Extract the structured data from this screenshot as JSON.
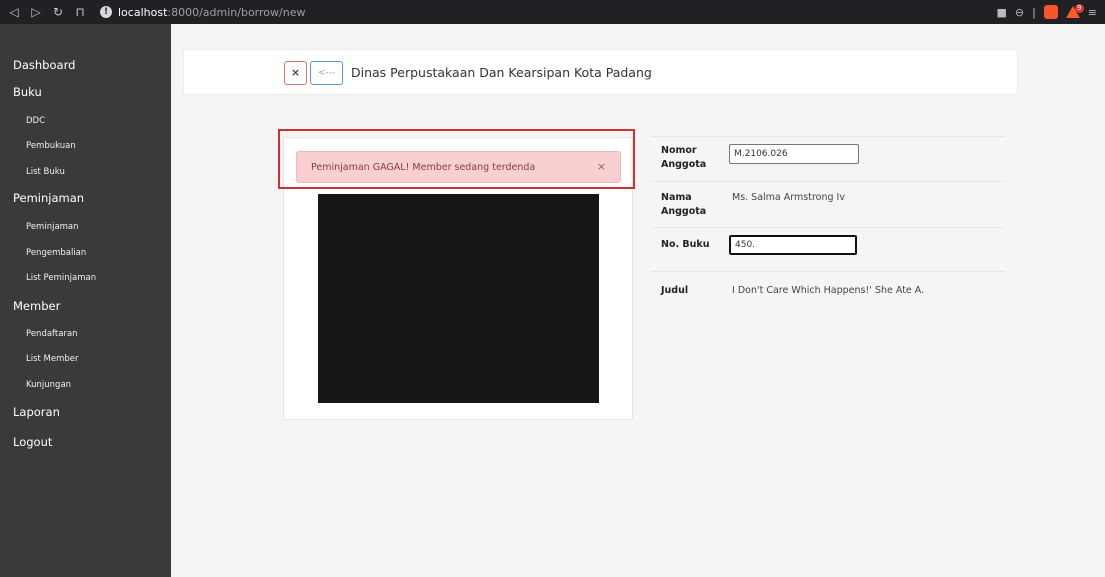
{
  "browser": {
    "url_host": "localhost",
    "url_rest": ":8000/admin/borrow/new",
    "extension_badge": "9"
  },
  "sidebar": {
    "sections": [
      {
        "label": "Dashboard",
        "items": []
      },
      {
        "label": "Buku",
        "items": [
          "DDC",
          "Pembukuan",
          "List Buku"
        ]
      },
      {
        "label": "Peminjaman",
        "items": [
          "Peminjaman",
          "Pengembalian",
          "List Peminjaman"
        ]
      },
      {
        "label": "Member",
        "items": [
          "Pendaftaran",
          "List Member",
          "Kunjungan"
        ]
      },
      {
        "label": "Laporan",
        "items": []
      },
      {
        "label": "Logout",
        "items": []
      }
    ]
  },
  "header": {
    "close_label": "×",
    "back_label": "<---",
    "title": "Dinas Perpustakaan Dan Kearsipan Kota Padang"
  },
  "alert": {
    "message": "Peminjaman GAGAL! Member sedang terdenda",
    "close_label": "×"
  },
  "form": {
    "nomor_anggota_label": "Nomor Anggota",
    "nomor_anggota_value": "M.2106.026",
    "nama_anggota_label": "Nama Anggota",
    "nama_anggota_value": "Ms. Salma Armstrong Iv",
    "no_buku_label": "No. Buku",
    "no_buku_value": "450.",
    "judul_label": "Judul",
    "judul_value": "I Don't Care Which Happens!' She Ate A."
  },
  "colors": {
    "sidebar_bg": "#3a3a3a",
    "alert_bg": "#f8d0d2",
    "highlight_border": "#d32f2f"
  }
}
